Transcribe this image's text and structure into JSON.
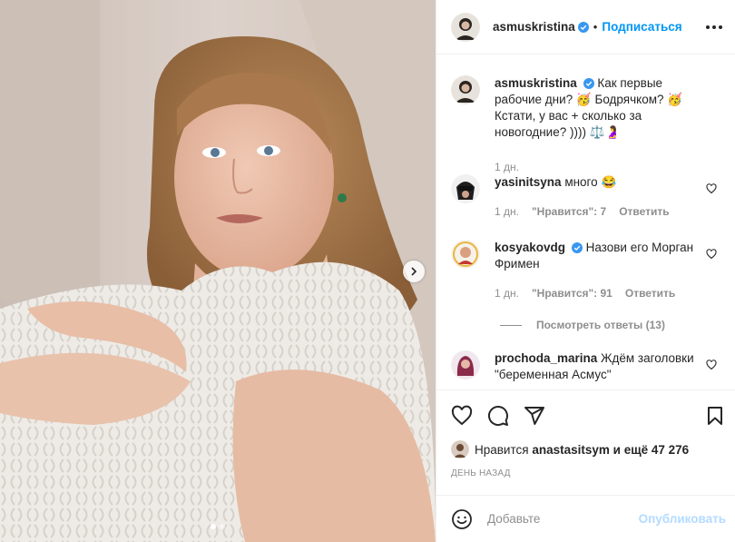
{
  "post": {
    "author": "asmuskristina",
    "follow_label": "Подписаться",
    "separator": "•",
    "caption": "Как первые рабочие дни? 🥳 Бодрячком? 🥳 Кстати, у вас + сколько за новогодние? )))) ⚖️🤰",
    "caption_age": "1 дн."
  },
  "comments": [
    {
      "user": "yasinitsyna",
      "text": "много 😂",
      "age": "1 дн.",
      "likes": "\"Нравится\": 7",
      "reply": "Ответить"
    },
    {
      "user": "kosyakovdg",
      "text": "Назови его Морган Фримен",
      "age": "1 дн.",
      "likes": "\"Нравится\": 91",
      "reply": "Ответить"
    },
    {
      "user": "prochoda_marina",
      "text": "Ждём заголовки \"беременная Асмус\""
    }
  ],
  "view_replies": "Посмотреть ответы (13)",
  "likes": {
    "prefix": "Нравится",
    "user": "anastasitsym",
    "rest": "и ещё 47 276"
  },
  "date": "ДЕНЬ НАЗАД",
  "add_comment": {
    "placeholder": "Добавьте",
    "publish": "Опубликовать"
  },
  "icons": {
    "carousel_next": "chevron-right-icon",
    "like": "heart-icon",
    "comment": "comment-icon",
    "share": "share-icon",
    "save": "bookmark-icon",
    "emoji": "smiley-icon",
    "verified": "verified-badge-icon",
    "more": "more-options-icon"
  },
  "colors": {
    "accent": "#0095f6",
    "verified": "#3897f0",
    "muted": "#8e8e8e",
    "publish_disabled": "#b3dbff"
  }
}
